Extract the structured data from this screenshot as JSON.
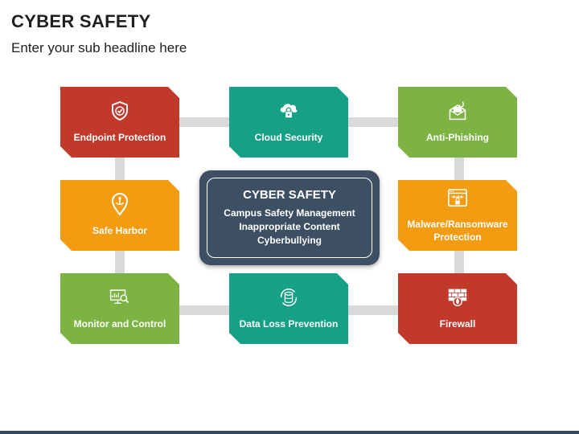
{
  "header": {
    "title": "CYBER SAFETY",
    "subtitle": "Enter your sub headline here"
  },
  "center": {
    "title": "CYBER SAFETY",
    "lines": [
      "Campus Safety Management",
      "Inappropriate Content",
      "Cyberbullying"
    ]
  },
  "cards": [
    {
      "label": "Endpoint Protection",
      "color": "#c0392b",
      "icon": "shield-check-icon"
    },
    {
      "label": "Cloud Security",
      "color": "#16a085",
      "icon": "cloud-lock-icon"
    },
    {
      "label": "Anti-Phishing",
      "color": "#7cb342",
      "icon": "envelope-hook-icon"
    },
    {
      "label": "Safe Harbor",
      "color": "#f39c12",
      "icon": "anchor-pin-icon"
    },
    {
      "label": "Malware/Ransomware\nProtection",
      "color": "#f39c12",
      "icon": "browser-lock-icon"
    },
    {
      "label": "Monitor and Control",
      "color": "#7cb342",
      "icon": "monitor-search-icon"
    },
    {
      "label": "Data Loss Prevention",
      "color": "#16a085",
      "icon": "database-cycle-icon"
    },
    {
      "label": "Firewall",
      "color": "#c0392b",
      "icon": "firewall-icon"
    }
  ],
  "colors": {
    "connector": "#d9d9d9",
    "center": "#3d4f63"
  }
}
